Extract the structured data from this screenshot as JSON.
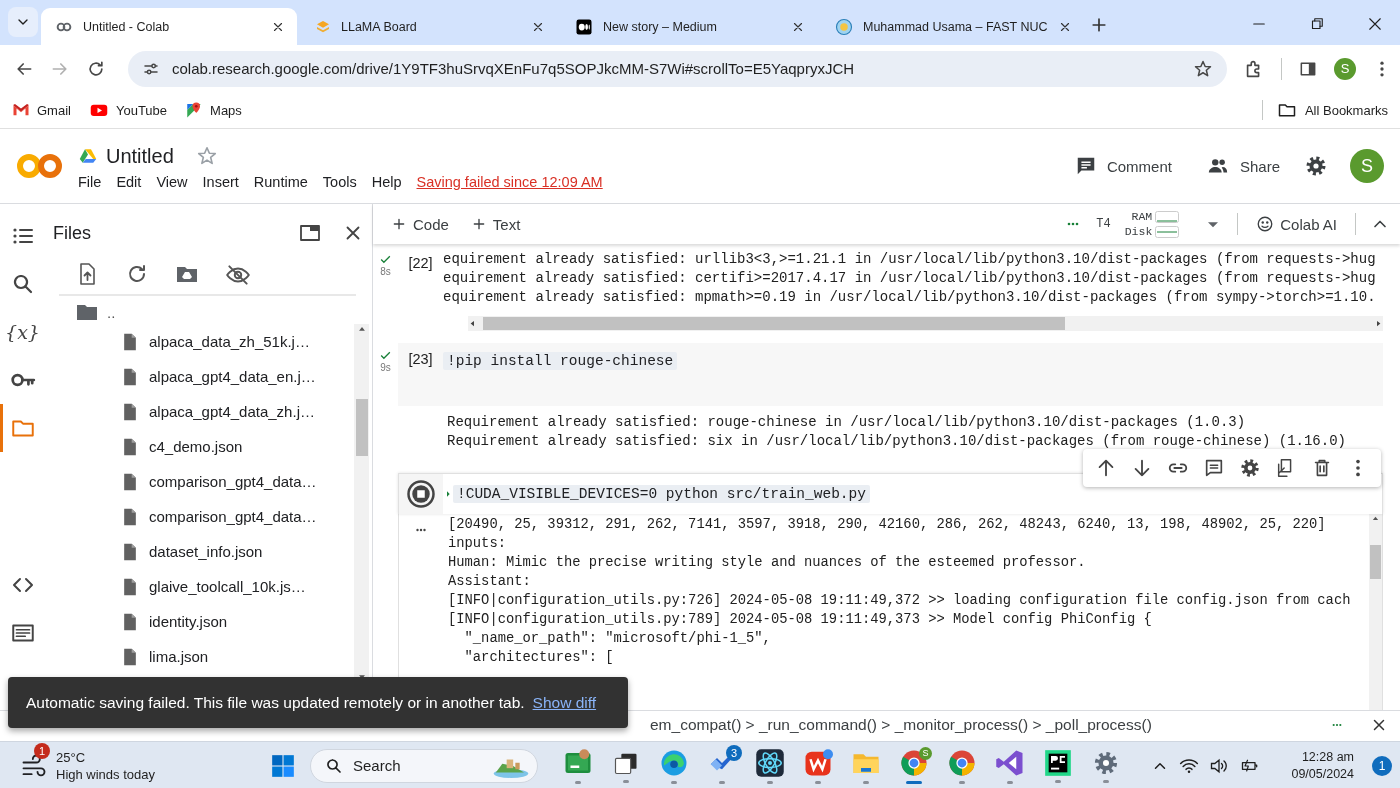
{
  "browser": {
    "tabs": [
      {
        "title": "Untitled - Colab",
        "kind": "colab",
        "selected": true
      },
      {
        "title": "LLaMA Board",
        "kind": "llama",
        "selected": false
      },
      {
        "title": "New story – Medium",
        "kind": "medium",
        "selected": false
      },
      {
        "title": "Muhammad Usama – FAST NUC",
        "kind": "site",
        "selected": false
      }
    ],
    "url": "colab.research.google.com/drive/1Y9TF3huSrvqXEnFu7q5SOPJkcMM-S7Wi#scrollTo=E5YaqpryxJCH",
    "profile_letter": "S",
    "bookmarks": [
      {
        "label": "Gmail",
        "kind": "gmail"
      },
      {
        "label": "YouTube",
        "kind": "youtube"
      },
      {
        "label": "Maps",
        "kind": "maps"
      }
    ],
    "all_bookmarks": "All Bookmarks"
  },
  "header": {
    "title": "Untitled",
    "menu": [
      "File",
      "Edit",
      "View",
      "Insert",
      "Runtime",
      "Tools",
      "Help"
    ],
    "save_status": "Saving failed since 12:09 AM",
    "comment": "Comment",
    "share": "Share",
    "avatar_letter": "S"
  },
  "toolbar": {
    "add_code": "Code",
    "add_text": "Text",
    "runtime": "T4",
    "ram": "RAM",
    "disk": "Disk",
    "ai": "Colab AI"
  },
  "rail_top": [
    {
      "kind": "toc",
      "selected": false
    },
    {
      "kind": "search",
      "selected": false
    },
    {
      "kind": "variables",
      "glyph": "{x}",
      "selected": false
    },
    {
      "kind": "secrets",
      "selected": false
    },
    {
      "kind": "files",
      "selected": true
    }
  ],
  "rail_bottom": [
    {
      "kind": "code",
      "selected": false
    },
    {
      "kind": "terminal",
      "selected": false
    }
  ],
  "files": {
    "title": "Files",
    "parent": "..",
    "items": [
      "alpaca_data_zh_51k.j…",
      "alpaca_gpt4_data_en.j…",
      "alpaca_gpt4_data_zh.j…",
      "c4_demo.json",
      "comparison_gpt4_data…",
      "comparison_gpt4_data…",
      "dataset_info.json",
      "glaive_toolcall_10k.js…",
      "identity.json",
      "lima.json"
    ]
  },
  "cells": [
    {
      "kind": "output",
      "done": true,
      "count": "[22]",
      "time": "8s",
      "output": [
        "equirement already satisfied: urllib3<3,>=1.21.1 in /usr/local/lib/python3.10/dist-packages (from requests->hug",
        "equirement already satisfied: certifi>=2017.4.17 in /usr/local/lib/python3.10/dist-packages (from requests->hug",
        "equirement already satisfied: mpmath>=0.19 in /usr/local/lib/python3.10/dist-packages (from sympy->torch>=1.10."
      ]
    },
    {
      "kind": "code",
      "done": true,
      "count": "[23]",
      "time": "9s",
      "code": "!pip install rouge-chinese",
      "output": [
        "Requirement already satisfied: rouge-chinese in /usr/local/lib/python3.10/dist-packages (1.0.3)",
        "Requirement already satisfied: six in /usr/local/lib/python3.10/dist-packages (from rouge-chinese) (1.16.0)"
      ]
    },
    {
      "kind": "code",
      "done": false,
      "code": "!CUDA_VISIBLE_DEVICES=0 python src/train_web.py",
      "output": [
        "[20490, 25, 39312, 291, 262, 7141, 3597, 3918, 290, 42160, 286, 262, 48243, 6240, 13, 198, 48902, 25, 220]",
        "inputs:",
        "Human: Mimic the precise writing style and nuances of the esteemed professor.",
        "Assistant:",
        "[INFO|configuration_utils.py:726] 2024-05-08 19:11:49,372 >> loading configuration file config.json from cach",
        "[INFO|configuration_utils.py:789] 2024-05-08 19:11:49,373 >> Model config PhiConfig {",
        "  \"_name_or_path\": \"microsoft/phi-1_5\",",
        "  \"architectures\": ["
      ]
    }
  ],
  "toast": {
    "message": "Automatic saving failed. This file was updated remotely or in another tab.",
    "link": "Show diff"
  },
  "status_bar": {
    "trace": "em_compat() > _run_command() > _monitor_process() > _poll_process()"
  },
  "taskbar": {
    "weather": {
      "badge": "1",
      "temp": "25°C",
      "text": "High winds today"
    },
    "search": "Search",
    "apps": [
      {
        "kind": "board",
        "selected": false
      },
      {
        "kind": "stack",
        "selected": false
      },
      {
        "kind": "edge",
        "selected": false
      },
      {
        "kind": "todo",
        "badge": "3",
        "selected": false
      },
      {
        "kind": "atom",
        "selected": false
      },
      {
        "kind": "wps",
        "selected": false
      },
      {
        "kind": "folder",
        "selected": false
      },
      {
        "kind": "chrome",
        "profile": "S",
        "selected": true
      },
      {
        "kind": "chrome",
        "selected": false
      },
      {
        "kind": "vs",
        "selected": false
      },
      {
        "kind": "pycharm",
        "selected": false
      },
      {
        "kind": "gear",
        "selected": false
      }
    ],
    "time": "12:28 am",
    "date": "09/05/2024",
    "notifications": "1"
  }
}
